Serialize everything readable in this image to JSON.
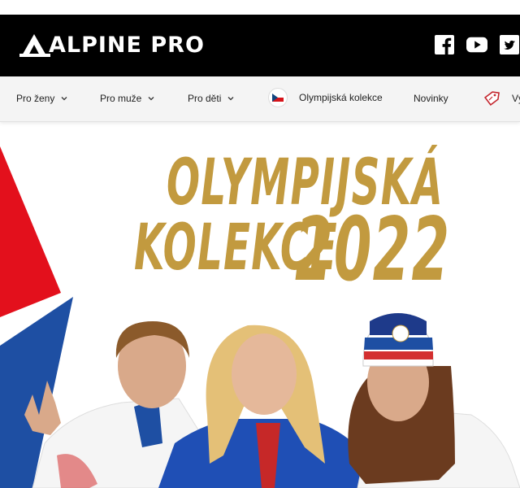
{
  "brand": {
    "name": "ALPINE PRO"
  },
  "social": [
    {
      "icon": "facebook-icon"
    },
    {
      "icon": "youtube-icon"
    },
    {
      "icon": "twitter-icon"
    }
  ],
  "nav": {
    "items": [
      {
        "label": "Pro ženy",
        "has_dropdown": true
      },
      {
        "label": "Pro muže",
        "has_dropdown": true
      },
      {
        "label": "Pro děti",
        "has_dropdown": true
      },
      {
        "label": "Olympijská kolekce",
        "has_dropdown": false,
        "icon": "czech-flag-icon"
      },
      {
        "label": "Novinky",
        "has_dropdown": false
      },
      {
        "label": "Vý",
        "has_dropdown": false,
        "icon": "price-tag-icon"
      }
    ]
  },
  "hero": {
    "title_line1": "OLYMPIJSKÁ",
    "title_line2": "KOLEKCE",
    "title_year": "2022",
    "jacket_brand": "ALPINE PRO"
  },
  "colors": {
    "header_bg": "#000000",
    "nav_bg": "#f4f4f4",
    "gold": "#c29a3f",
    "flag_red": "#e3101c",
    "flag_blue": "#1e4fa3"
  }
}
